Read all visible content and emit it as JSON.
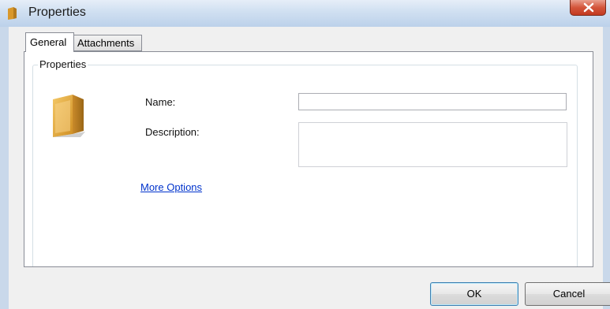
{
  "window": {
    "title": "Properties",
    "close_symbol": "X"
  },
  "tabs": [
    {
      "label": "General",
      "active": true
    },
    {
      "label": "Attachments",
      "active": false
    }
  ],
  "group": {
    "title": "Properties",
    "icon": "folder-icon"
  },
  "form": {
    "name_label": "Name:",
    "name_value": "",
    "description_label": "Description:",
    "description_value": "",
    "more_options_link": "More Options"
  },
  "buttons": {
    "ok": "OK",
    "cancel": "Cancel"
  },
  "colors": {
    "link": "#0033cc",
    "titlebar": "#cfdff1",
    "close_button": "#d4553b",
    "folder": "#e2a93a"
  }
}
